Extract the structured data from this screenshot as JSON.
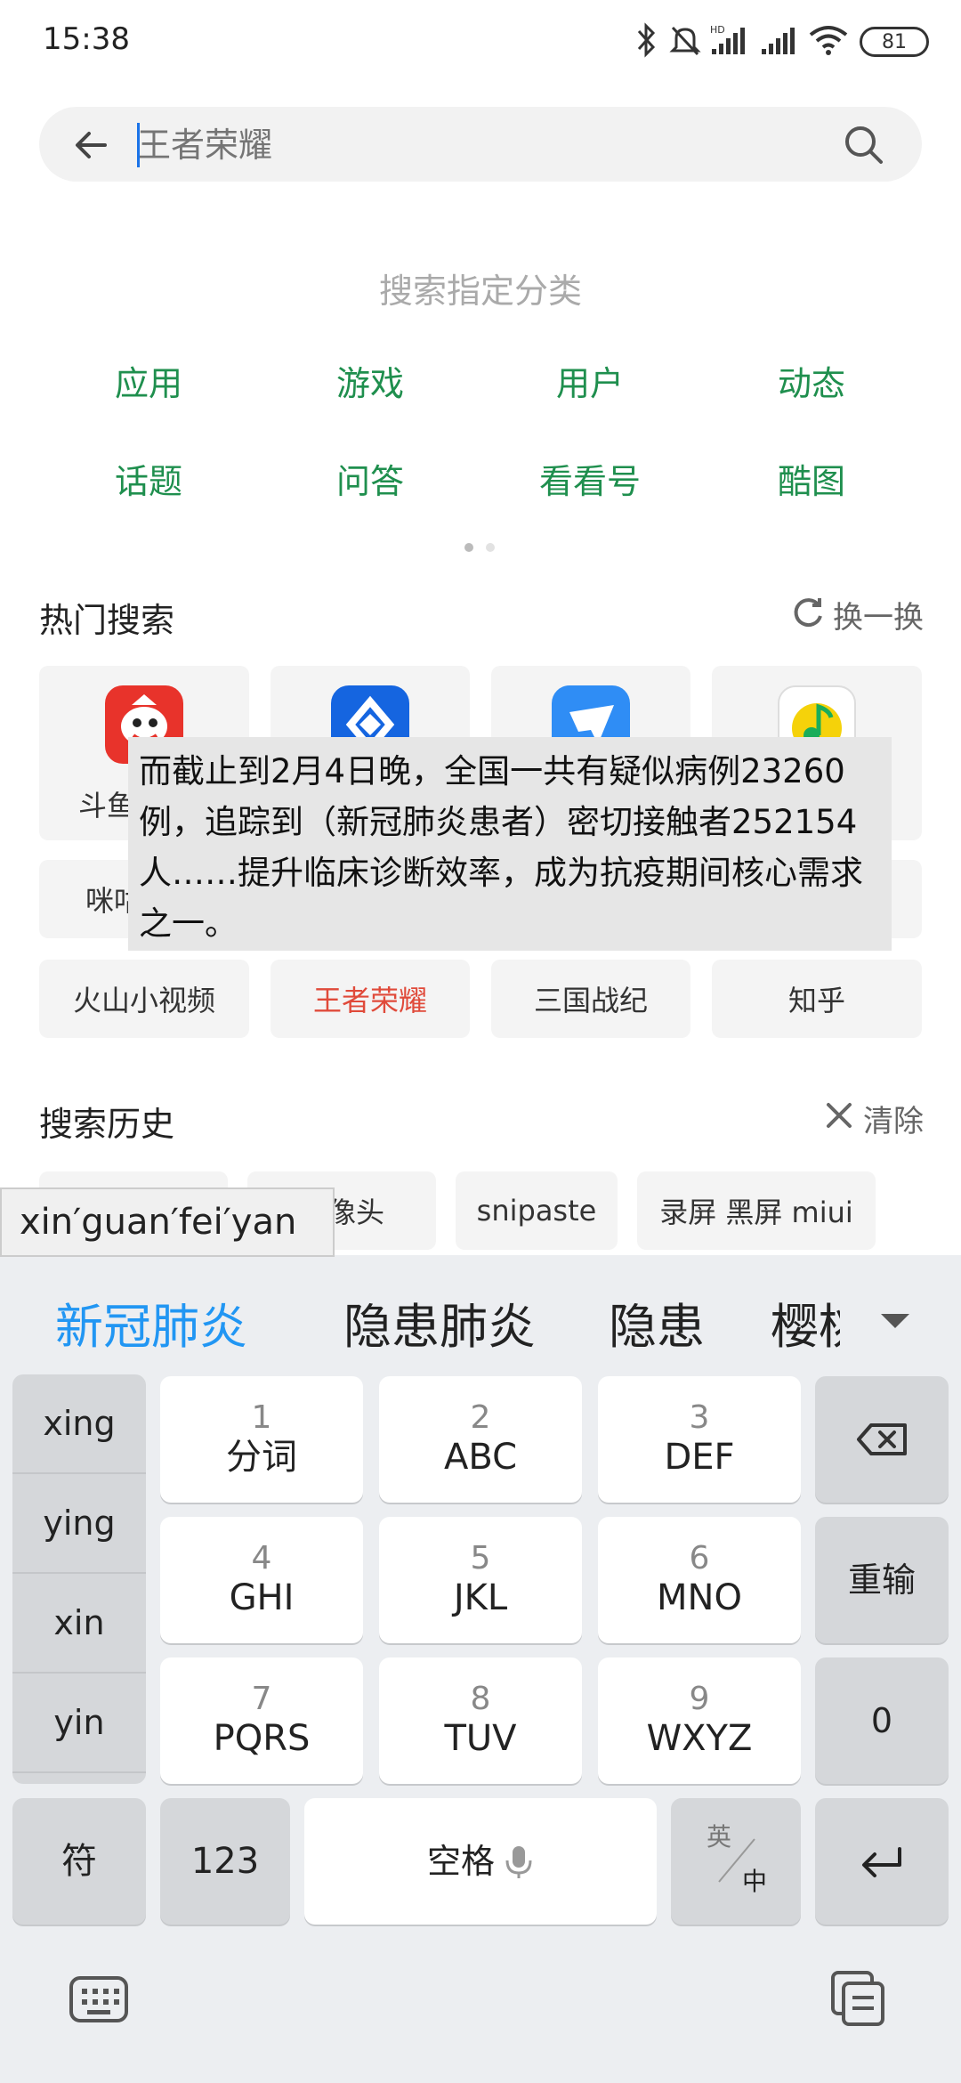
{
  "status_bar": {
    "time": "15:38",
    "battery": "81"
  },
  "search": {
    "placeholder": "王者荣耀"
  },
  "categories": {
    "title": "搜索指定分类",
    "items": [
      "应用",
      "游戏",
      "用户",
      "动态",
      "话题",
      "问答",
      "看看号",
      "酷图"
    ]
  },
  "hot_search": {
    "title": "热门搜索",
    "refresh_label": "换一换",
    "apps": [
      {
        "name": "斗鱼",
        "icon": "douyu-icon",
        "color": "#e8332b"
      },
      {
        "name": "",
        "icon": "app-blue-diamond-icon",
        "color": "#1565e0"
      },
      {
        "name": "",
        "icon": "app-blue-bird-icon",
        "color": "#2f8df5"
      },
      {
        "name": "",
        "icon": "qq-music-icon",
        "color": "#f5d20a"
      }
    ],
    "row2": [
      "咪咕",
      "",
      "",
      ""
    ],
    "row3": [
      "火山小视频",
      "王者荣耀",
      "三国战纪",
      "知乎"
    ]
  },
  "overlay_text": "而截止到2月4日晚，全国一共有疑似病例23260例，追踪到（新冠肺炎患者）密切接触者252154人……提升临床诊断效率，成为抗疫期间核心需求之一。",
  "history": {
    "title": "搜索历史",
    "clear_label": "清除",
    "items": [
      "",
      "摄像头",
      "snipaste",
      "录屏 黑屏 miui"
    ]
  },
  "ime": {
    "composing": "xin′guan′fei′yan",
    "candidates": [
      "新冠肺炎",
      "隐患肺炎",
      "隐患",
      "樱桃"
    ],
    "side_options": [
      "xing",
      "ying",
      "xin",
      "yin"
    ],
    "keys": [
      {
        "num": "1",
        "label": "分词"
      },
      {
        "num": "2",
        "label": "ABC"
      },
      {
        "num": "3",
        "label": "DEF"
      },
      {
        "num": "4",
        "label": "GHI"
      },
      {
        "num": "5",
        "label": "JKL"
      },
      {
        "num": "6",
        "label": "MNO"
      },
      {
        "num": "7",
        "label": "PQRS"
      },
      {
        "num": "8",
        "label": "TUV"
      },
      {
        "num": "9",
        "label": "WXYZ"
      }
    ],
    "reinput": "重输",
    "zero": "0",
    "symbol": "符",
    "num_switch": "123",
    "space": "空格",
    "lang_top": "英",
    "lang_bottom": "中",
    "accent_color": "#2196f3"
  }
}
